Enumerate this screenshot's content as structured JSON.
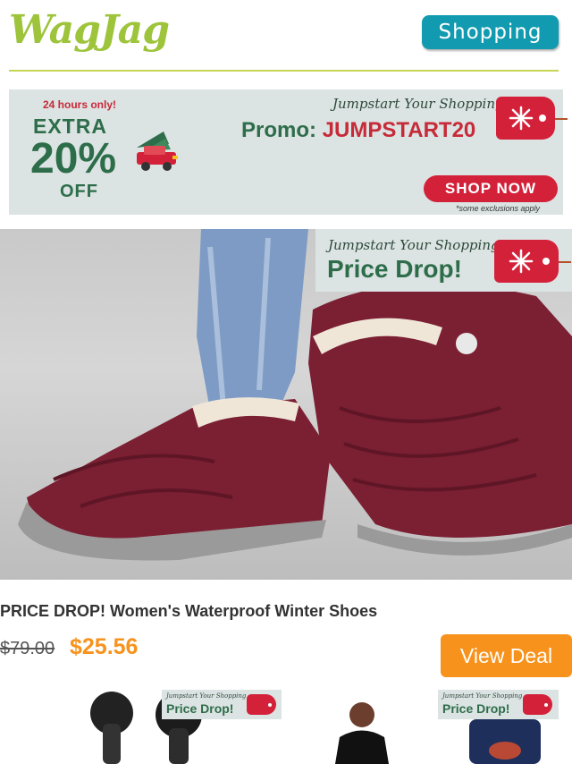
{
  "header": {
    "logo": "WagJag",
    "shopping_button": "Shopping"
  },
  "banner": {
    "hours": "24 hours only!",
    "extra": "EXTRA",
    "percent": "20%",
    "off": "OFF",
    "headline": "Jumpstart Your Shopping",
    "promo_label": "Promo:",
    "promo_code": "JUMPSTART20",
    "cta": "SHOP NOW",
    "note": "*some exclusions apply"
  },
  "badge": {
    "headline": "Jumpstart Your Shopping",
    "text": "Price Drop!"
  },
  "product": {
    "title": "PRICE DROP! Women's Waterproof Winter Shoes",
    "old_price": "$79.00",
    "new_price": "$25.56",
    "cta": "View Deal"
  },
  "icons": {
    "snowflake": "snowflake-icon",
    "car": "car-with-tree-icon"
  },
  "colors": {
    "brand_green": "#9dc43a",
    "teal": "#129bb0",
    "red": "#d4213a",
    "orange": "#f7931d",
    "dark_green": "#2e6d4a"
  }
}
